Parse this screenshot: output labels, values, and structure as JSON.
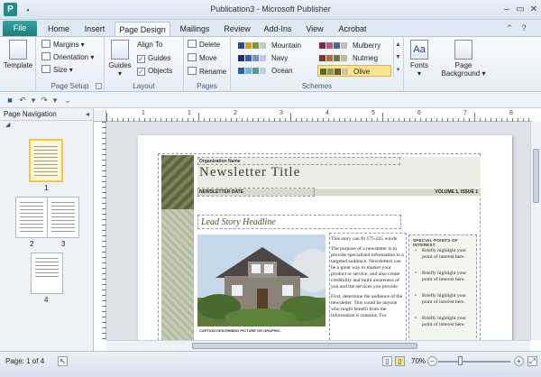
{
  "window": {
    "app_icon": "P",
    "title": "Publication3 - Microsoft Publisher",
    "controls": [
      "–",
      "▭",
      "✕"
    ]
  },
  "tabs": {
    "file": "File",
    "items": [
      "Home",
      "Insert",
      "Page Design",
      "Mailings",
      "Review",
      "Add-Ins",
      "View",
      "Acrobat"
    ],
    "active": "Page Design"
  },
  "ribbon": {
    "template": {
      "label": "Template",
      "group": ""
    },
    "page_setup": {
      "margins": "Margins",
      "orientation": "Orientation",
      "size": "Size",
      "group": "Page Setup"
    },
    "layout": {
      "guides": "Guides",
      "align_to": "Align To",
      "guides_check": "Guides",
      "objects_check": "Objects",
      "group": "Layout"
    },
    "pages": {
      "delete": "Delete",
      "move": "Move",
      "rename": "Rename",
      "group": "Pages"
    },
    "schemes": {
      "group": "Schemes",
      "items": [
        {
          "name": "Mountain",
          "colors": [
            "#2e4a8c",
            "#d6a01e",
            "#7a9a3a",
            "#c7c7c7",
            "#e6e6e6"
          ]
        },
        {
          "name": "Navy",
          "colors": [
            "#1d2f6e",
            "#3c5aa6",
            "#7a8fc8",
            "#c0c8e0",
            "#e6e6e6"
          ]
        },
        {
          "name": "Ocean",
          "colors": [
            "#2b5fa5",
            "#78b0dc",
            "#5a9a8a",
            "#b8d0e8",
            "#e6e6e6"
          ]
        },
        {
          "name": "Mulberry",
          "colors": [
            "#7a2a5a",
            "#b15a7a",
            "#4a6a8c",
            "#c0c0c0",
            "#e6e6e6"
          ]
        },
        {
          "name": "Nutmeg",
          "colors": [
            "#7a3a28",
            "#b86a3a",
            "#6a7a4a",
            "#c8b898",
            "#e6e6e6"
          ]
        },
        {
          "name": "Olive",
          "colors": [
            "#5a6a2a",
            "#8a9a4a",
            "#6a5a3a",
            "#c8c8a8",
            "#e6e6e6"
          ]
        }
      ],
      "selected": "Olive"
    },
    "fonts": {
      "label": "Fonts",
      "glyph": "Aa"
    },
    "page_background": {
      "label": "Page Background"
    }
  },
  "nav": {
    "title": "Page Navigation",
    "pages": [
      "1",
      "2",
      "3",
      "4"
    ]
  },
  "ruler": {
    "labels": [
      "1",
      "1",
      "2",
      "3",
      "4",
      "5",
      "6",
      "7",
      "8"
    ]
  },
  "publication": {
    "org_name": "Organization Name",
    "title": "Newsletter Title",
    "date": "NEWSLETTER DATE",
    "volume": "VOLUME 1, ISSUE 1",
    "headline": "Lead Story Headline",
    "caption": "Caption describing picture or graphic.",
    "story_paragraphs": [
      "This story can fit 175-225 words.",
      "The purpose of a newsletter is to provide specialized information to a targeted audience. Newsletters can be a great way to market your product or service, and also create credibility and build awareness of you and the services you provide.",
      "First, determine the audience of the newsletter. This could be anyone who might benefit from the information it contains. For"
    ],
    "special_heading": "SPECIAL POINTS OF INTEREST:",
    "special_points": [
      "Briefly highlight your point of interest here.",
      "Briefly highlight your point of interest here.",
      "Briefly highlight your point of interest here.",
      "Briefly highlight your point of interest here."
    ]
  },
  "status": {
    "page": "Page: 1 of 4",
    "zoom": "70%"
  }
}
